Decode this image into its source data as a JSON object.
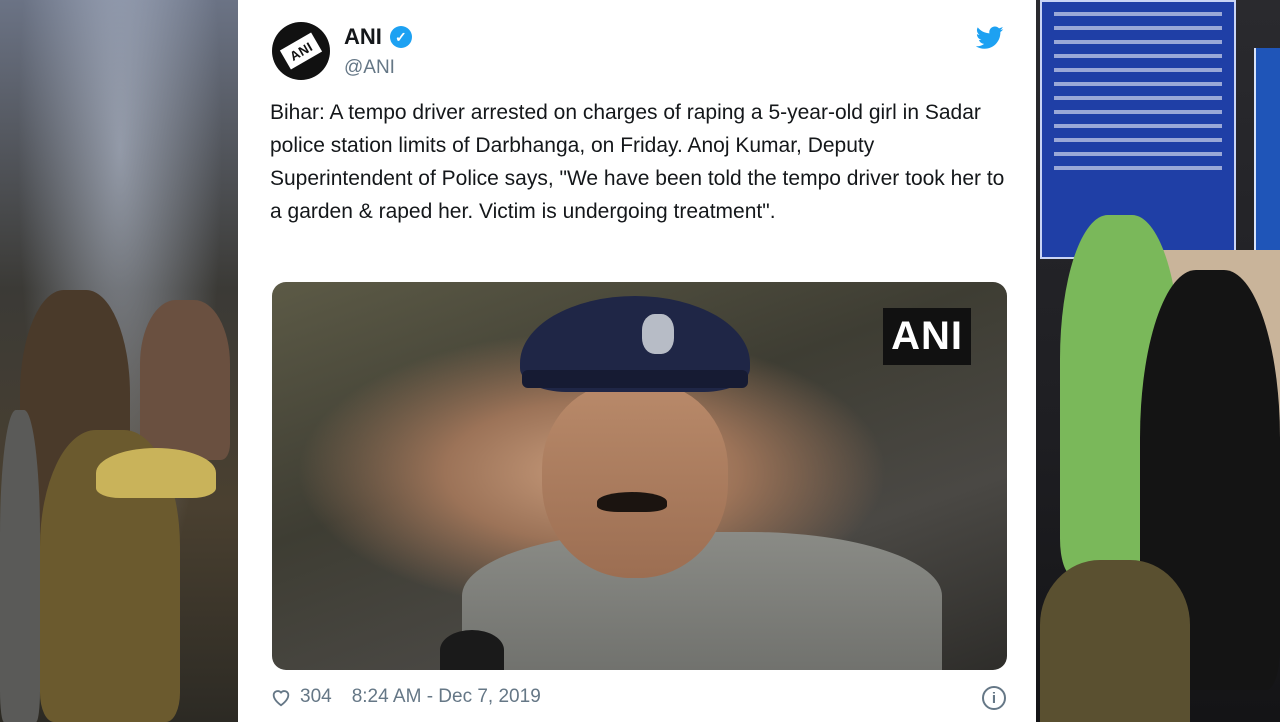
{
  "tweet": {
    "author_name": "ANI",
    "handle": "@ANI",
    "avatar_text": "ANI",
    "text": "Bihar: A tempo driver arrested on charges of raping a 5-year-old girl in Sadar police station limits of Darbhanga, on Friday. Anoj Kumar, Deputy Superintendent of Police says, \"We have been told the tempo driver took her to a garden & raped her. Victim is undergoing treatment\".",
    "media_watermark": "ANI",
    "likes": "304",
    "timestamp": "8:24 AM - Dec 7, 2019"
  },
  "icons": {
    "verified": "verified-badge-icon",
    "platform": "twitter-bird-icon",
    "like": "heart-icon",
    "info": "info-icon"
  },
  "colors": {
    "twitter_blue": "#1da1f2",
    "text_primary": "#14171a",
    "text_secondary": "#657786"
  }
}
